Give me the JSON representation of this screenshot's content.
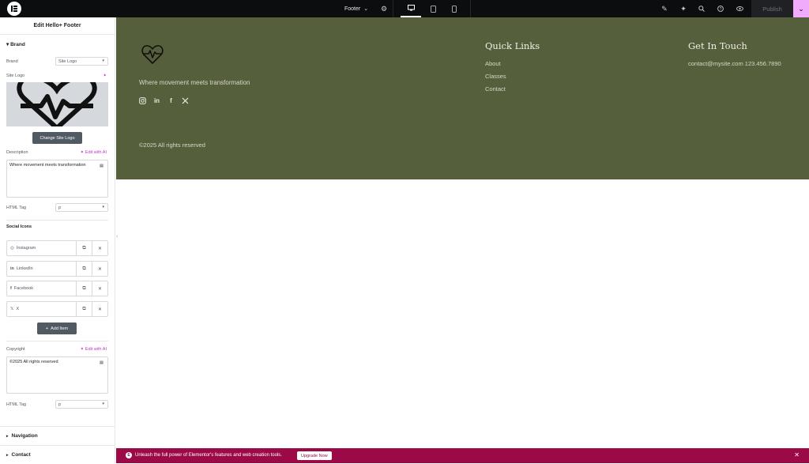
{
  "topbar": {
    "document_name": "Footer",
    "publish_label": "Publish"
  },
  "panel": {
    "title": "Edit Hello+ Footer",
    "brand": {
      "section_label": "Brand",
      "brand_label": "Brand",
      "brand_value": "Site Logo",
      "site_logo_label": "Site Logo",
      "change_logo_label": "Change Site Logo",
      "description_label": "Description",
      "edit_ai_label": "Edit with AI",
      "description_value": "Where movement meets transformation",
      "html_tag_label": "HTML Tag",
      "html_tag_value": "p"
    },
    "social": {
      "section_label": "Social Icons",
      "items": [
        {
          "label": "Instagram",
          "icon": "instagram-icon"
        },
        {
          "label": "LinkedIn",
          "icon": "linkedin-icon"
        },
        {
          "label": "Facebook",
          "icon": "facebook-icon"
        },
        {
          "label": "X",
          "icon": "x-icon"
        }
      ],
      "add_item_label": "Add Item"
    },
    "copyright": {
      "label": "Copyright",
      "edit_ai_label": "Edit with AI",
      "value": "©2025 All rights reserved",
      "html_tag_label": "HTML Tag",
      "html_tag_value": "p"
    },
    "sections": {
      "navigation": "Navigation",
      "contact": "Contact"
    }
  },
  "footer": {
    "description": "Where movement meets transformation",
    "copyright": "©2025 All rights reserved",
    "quick_links_heading": "Quick Links",
    "links": [
      "About",
      "Classes",
      "Contact"
    ],
    "contact_heading": "Get In Touch",
    "contact_text": "contact@mysite.com 123.456.7890"
  },
  "promo": {
    "text": "Unleash the full power of Elementor's features and web creation tools.",
    "button": "Upgrade Now"
  },
  "colors": {
    "footer_bg": "#565f3c",
    "promo_bg": "#9b0a46",
    "ai_accent": "#c036c6",
    "publish_accent": "#f0abfc"
  }
}
